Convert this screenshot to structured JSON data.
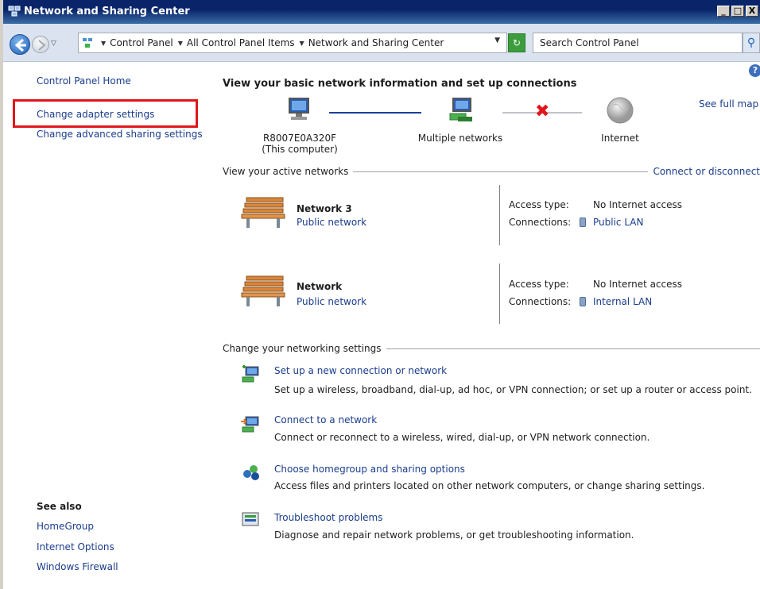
{
  "window": {
    "title": "Network and Sharing Center",
    "minimize": "_",
    "maximize": "□",
    "close": "X"
  },
  "address_bar": {
    "breadcrumb": [
      "Control Panel",
      "All Control Panel Items",
      "Network and Sharing Center"
    ],
    "search_placeholder": "Search Control Panel"
  },
  "left_pane": {
    "links": [
      "Control Panel Home",
      "Change adapter settings",
      "Change advanced sharing settings"
    ],
    "see_also_title": "See also",
    "see_also": [
      "HomeGroup",
      "Internet Options",
      "Windows Firewall"
    ]
  },
  "main": {
    "heading": "View your basic network information and set up connections",
    "see_full_map": "See full map",
    "map": {
      "computer_name": "R8007E0A320F",
      "computer_sub": "(This computer)",
      "middle": "Multiple networks",
      "internet": "Internet"
    },
    "active_networks_title": "View your active networks",
    "connect_link": "Connect or disconnect",
    "networks": [
      {
        "name": "Network  3",
        "category": "Public network",
        "access_label": "Access type:",
        "access_value": "No Internet access",
        "conn_label": "Connections:",
        "conn_value": "Public LAN"
      },
      {
        "name": "Network",
        "category": "Public network",
        "access_label": "Access type:",
        "access_value": "No Internet access",
        "conn_label": "Connections:",
        "conn_value": "Internal LAN"
      }
    ],
    "settings_title": "Change your networking settings",
    "tasks": [
      {
        "title": "Set up a new connection or network",
        "desc": "Set up a wireless, broadband, dial-up, ad hoc, or VPN connection; or set up a router or access point."
      },
      {
        "title": "Connect to a network",
        "desc": "Connect or reconnect to a wireless, wired, dial-up, or VPN network connection."
      },
      {
        "title": "Choose homegroup and sharing options",
        "desc": "Access files and printers located on other network computers, or change sharing settings."
      },
      {
        "title": "Troubleshoot problems",
        "desc": "Diagnose and repair network problems, or get troubleshooting information."
      }
    ]
  },
  "colors": {
    "link": "#1a3d8c",
    "highlight_box": "#e0161b",
    "titlebar": "#0a246a"
  }
}
